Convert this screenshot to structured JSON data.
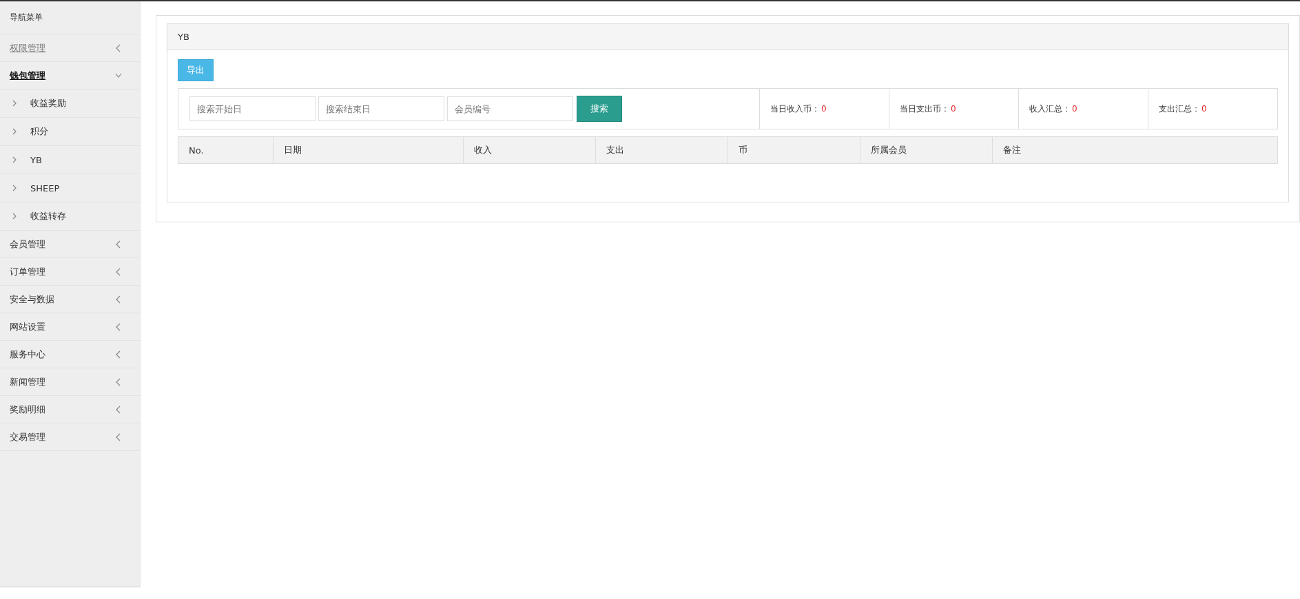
{
  "sidebar": {
    "title": "导航菜单",
    "items": [
      {
        "label": "权限管理",
        "selected": false,
        "visited": true,
        "expanded": false
      },
      {
        "label": "钱包管理",
        "selected": true,
        "visited": false,
        "expanded": true,
        "children": [
          {
            "label": "收益奖励"
          },
          {
            "label": "积分"
          },
          {
            "label": "YB"
          },
          {
            "label": "SHEEP"
          },
          {
            "label": "收益转存"
          }
        ]
      },
      {
        "label": "会员管理",
        "selected": false,
        "visited": false,
        "expanded": false
      },
      {
        "label": "订单管理",
        "selected": false,
        "visited": false,
        "expanded": false
      },
      {
        "label": "安全与数据",
        "selected": false,
        "visited": false,
        "expanded": false
      },
      {
        "label": "网站设置",
        "selected": false,
        "visited": false,
        "expanded": false
      },
      {
        "label": "服务中心",
        "selected": false,
        "visited": false,
        "expanded": false
      },
      {
        "label": "新闻管理",
        "selected": false,
        "visited": false,
        "expanded": false
      },
      {
        "label": "奖励明细",
        "selected": false,
        "visited": false,
        "expanded": false
      },
      {
        "label": "交易管理",
        "selected": false,
        "visited": false,
        "expanded": false
      }
    ]
  },
  "panel": {
    "title": "YB",
    "export_button": "导出",
    "search": {
      "fields": [
        {
          "placeholder": "搜索开始日"
        },
        {
          "placeholder": "搜索结束日"
        },
        {
          "placeholder": "会员编号"
        }
      ],
      "button": "搜索"
    },
    "stats": [
      {
        "label": "当日收入币：",
        "value": "0"
      },
      {
        "label": "当日支出币：",
        "value": "0"
      },
      {
        "label": "收入汇总：",
        "value": "0"
      },
      {
        "label": "支出汇总：",
        "value": "0"
      }
    ],
    "table": {
      "columns": [
        "No.",
        "日期",
        "收入",
        "支出",
        "币",
        "所属会员",
        "备注"
      ]
    }
  }
}
